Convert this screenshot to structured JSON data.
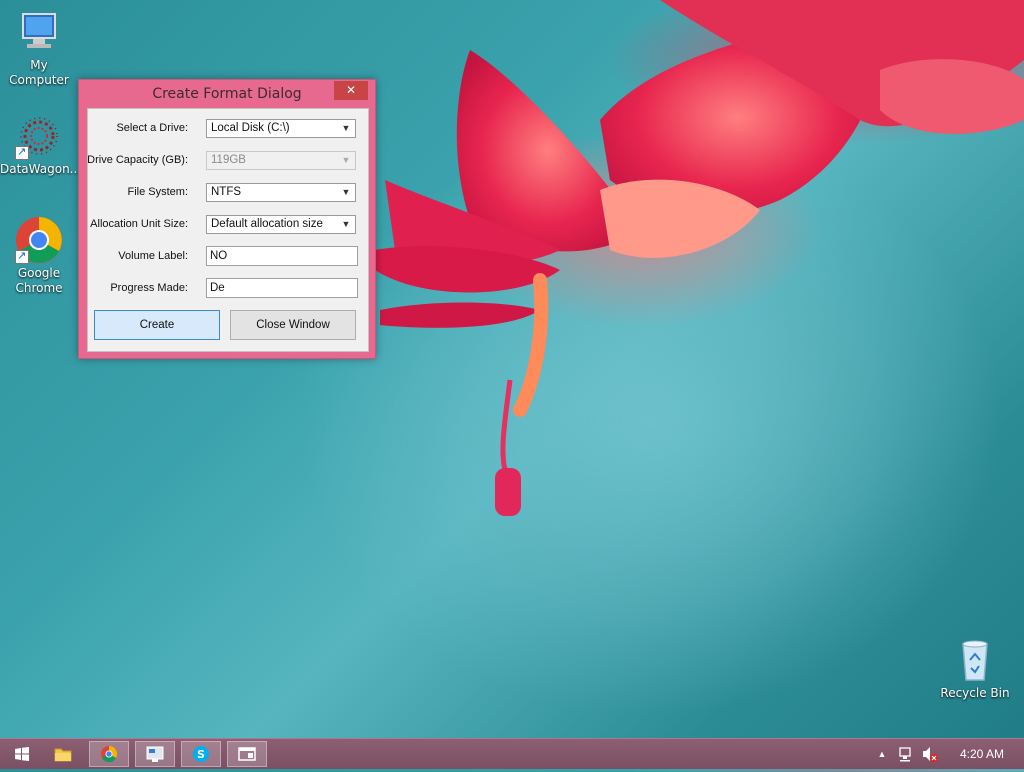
{
  "desktop": {
    "icons": [
      {
        "label": "My Computer",
        "icon": "my-computer-icon"
      },
      {
        "label": "DataWagon...",
        "icon": "datawagon-icon"
      },
      {
        "label": "Google Chrome",
        "icon": "chrome-icon"
      },
      {
        "label": "Recycle Bin",
        "icon": "recycle-bin-icon"
      }
    ]
  },
  "dialog": {
    "title": "Create Format Dialog",
    "close_glyph": "✕",
    "fields": {
      "drive": {
        "label": "Select a Drive:",
        "value": "Local Disk (C:\\)"
      },
      "capacity": {
        "label": "Drive Capacity (GB):",
        "value": "119GB"
      },
      "filesystem": {
        "label": "File System:",
        "value": "NTFS"
      },
      "allocation": {
        "label": "Allocation Unit Size:",
        "value": "Default allocation size"
      },
      "volume": {
        "label": "Volume Label:",
        "value": "NO"
      },
      "progress": {
        "label": "Progress Made:",
        "value": "De"
      }
    },
    "buttons": {
      "create": "Create",
      "close": "Close Window"
    }
  },
  "taskbar": {
    "items": [
      "start-icon",
      "file-explorer-icon",
      "chrome-icon",
      "network-window-icon",
      "skype-icon",
      "window-icon"
    ],
    "tray": {
      "expand_glyph": "▲",
      "time": "4:20 AM"
    }
  },
  "colors": {
    "dialog_frame": "#e7698f",
    "close_button": "#c74545",
    "taskbar": "#7b5063"
  }
}
